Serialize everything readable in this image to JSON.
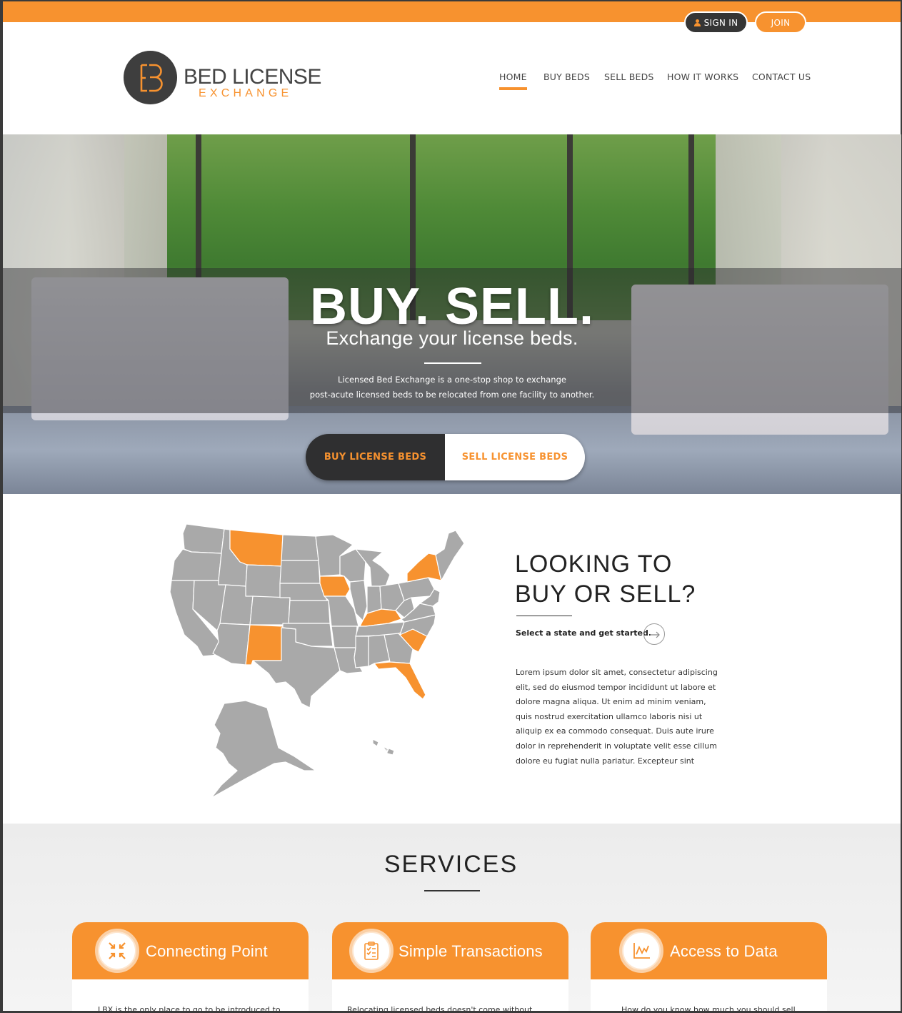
{
  "topbar": {
    "signin_label": "SIGN IN",
    "join_label": "JOIN"
  },
  "brand": {
    "name_line1": "BED LICENSE",
    "name_line2": "EXCHANGE"
  },
  "nav": [
    {
      "label": "HOME",
      "active": true
    },
    {
      "label": "BUY BEDS"
    },
    {
      "label": "SELL BEDS"
    },
    {
      "label": "HOW IT WORKS"
    },
    {
      "label": "CONTACT US"
    }
  ],
  "hero": {
    "title": "BUY. SELL.",
    "subtitle": "Exchange your license beds.",
    "desc_line1": "Licensed Bed Exchange is a one-stop shop to exchange",
    "desc_line2": "post-acute licensed beds to be relocated from one facility to another.",
    "buy_label": "BUY LICENSE BEDS",
    "sell_label": "SELL LICENSE BEDS"
  },
  "map_section": {
    "title_line1": "LOOKING TO",
    "title_line2": "BUY OR SELL?",
    "prompt": "Select a state and get started.",
    "body": "Lorem ipsum dolor sit amet, consectetur adipiscing elit, sed do eiusmod tempor incididunt ut labore et dolore magna aliqua. Ut enim ad minim veniam, quis nostrud exercitation ullamco laboris nisi ut aliquip ex ea commodo consequat. Duis aute irure dolor in reprehenderit in voluptate velit esse cillum dolore eu fugiat nulla pariatur. Excepteur sint",
    "highlighted_states": [
      "Montana",
      "Iowa",
      "New York",
      "Kentucky",
      "New Mexico",
      "South Carolina",
      "Florida"
    ]
  },
  "services": {
    "title": "SERVICES",
    "cards": [
      {
        "title": "Connecting Point",
        "icon": "arrows-converge-icon",
        "text": "LBX is the only place to go to be introduced to"
      },
      {
        "title": "Simple Transactions",
        "icon": "clipboard-checklist-icon",
        "text": "Relocating licensed beds doesn't come without"
      },
      {
        "title": "Access to Data",
        "icon": "line-chart-icon",
        "text": "How do you know how much you should sell"
      }
    ]
  },
  "colors": {
    "accent": "#f7922f",
    "dark": "#353535",
    "map_gray": "#a9a9a9"
  }
}
